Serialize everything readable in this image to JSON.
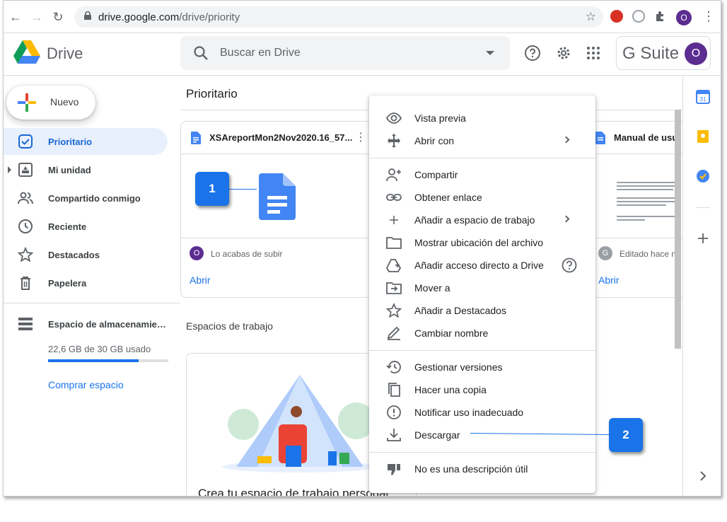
{
  "browser": {
    "url_host": "drive.google.com",
    "url_path": "/drive/priority",
    "profile_initial": "O"
  },
  "header": {
    "app_name": "Drive",
    "search_placeholder": "Buscar en Drive",
    "gsuite_label": "G Suite",
    "account_initial": "O"
  },
  "sidebar": {
    "new_label": "Nuevo",
    "items": [
      {
        "label": "Prioritario",
        "icon": "priority-icon",
        "active": true
      },
      {
        "label": "Mi unidad",
        "icon": "my-drive-icon"
      },
      {
        "label": "Compartido conmigo",
        "icon": "shared-icon"
      },
      {
        "label": "Reciente",
        "icon": "clock-icon"
      },
      {
        "label": "Destacados",
        "icon": "star-icon"
      },
      {
        "label": "Papelera",
        "icon": "trash-icon"
      }
    ],
    "storage_label": "Espacio de almacenamiento",
    "storage_used": "22,6 GB de 30 GB usado",
    "storage_fraction": 0.75,
    "buy_label": "Comprar espacio"
  },
  "main": {
    "title": "Prioritario",
    "cards": [
      {
        "name": "XSAreportMon2Nov2020.16_57...",
        "meta": "Lo acabas de subir",
        "avatar": "O",
        "open": "Abrir"
      },
      {
        "name": "Manual de usu",
        "meta": "Editado hace m",
        "avatar": "G",
        "open": "Abrir"
      }
    ],
    "workspaces_title": "Espacios de trabajo",
    "workspace_cta": "Crea tu espacio de trabajo personal"
  },
  "context_menu": {
    "groups": [
      [
        {
          "label": "Vista previa",
          "icon": "eye-icon"
        },
        {
          "label": "Abrir con",
          "icon": "move-arrows-icon",
          "submenu": true
        }
      ],
      [
        {
          "label": "Compartir",
          "icon": "person-add-icon"
        },
        {
          "label": "Obtener enlace",
          "icon": "link-icon"
        },
        {
          "label": "Añadir a espacio de trabajo",
          "icon": "plus-icon",
          "submenu": true
        },
        {
          "label": "Mostrar ubicación del archivo",
          "icon": "folder-icon"
        },
        {
          "label": "Añadir acceso directo a Drive",
          "icon": "drive-shortcut-icon",
          "help": true
        },
        {
          "label": "Mover a",
          "icon": "move-to-icon"
        },
        {
          "label": "Añadir a Destacados",
          "icon": "star-outline-icon"
        },
        {
          "label": "Cambiar nombre",
          "icon": "pencil-icon"
        }
      ],
      [
        {
          "label": "Gestionar versiones",
          "icon": "history-icon"
        },
        {
          "label": "Hacer una copia",
          "icon": "copy-icon"
        },
        {
          "label": "Notificar uso inadecuado",
          "icon": "report-icon"
        },
        {
          "label": "Descargar",
          "icon": "download-icon"
        }
      ],
      [
        {
          "label": "No es una descripción útil",
          "icon": "thumb-down-icon"
        }
      ]
    ]
  },
  "callouts": {
    "one": "1",
    "two": "2"
  },
  "colors": {
    "accent": "#1a73e8",
    "active_bg": "#e8f0fe",
    "avatar": "#5c2d91"
  }
}
